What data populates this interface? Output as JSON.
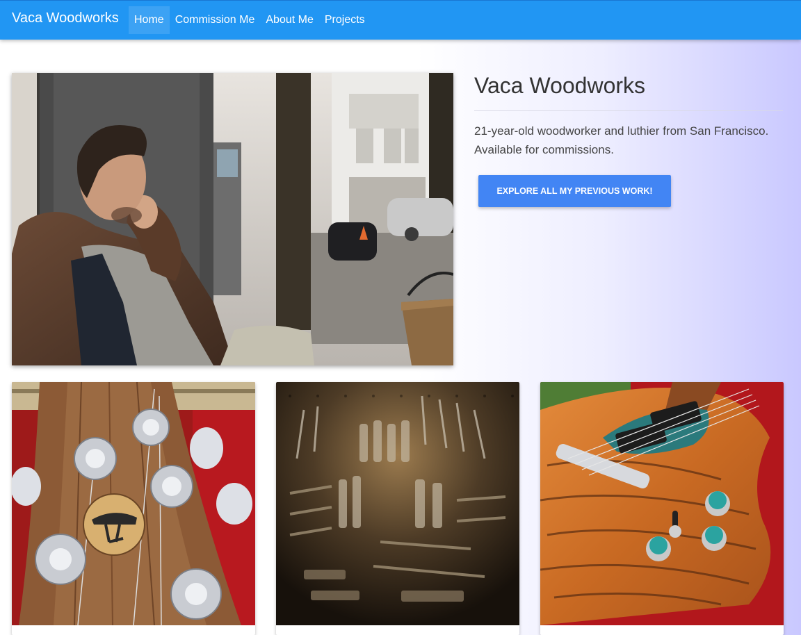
{
  "navbar": {
    "brand": "Vaca Woodworks",
    "links": [
      {
        "label": "Home",
        "active": true
      },
      {
        "label": "Commission Me",
        "active": false
      },
      {
        "label": "About Me",
        "active": false
      },
      {
        "label": "Projects",
        "active": false
      }
    ]
  },
  "hero": {
    "title": "Vaca Woodworks",
    "description": "21-year-old woodworker and luthier from San Francisco. Available for commissions.",
    "cta_label": "EXPLORE ALL MY PREVIOUS WORK!"
  },
  "colors": {
    "navbar": "#2196f3",
    "button": "#4285f4"
  }
}
